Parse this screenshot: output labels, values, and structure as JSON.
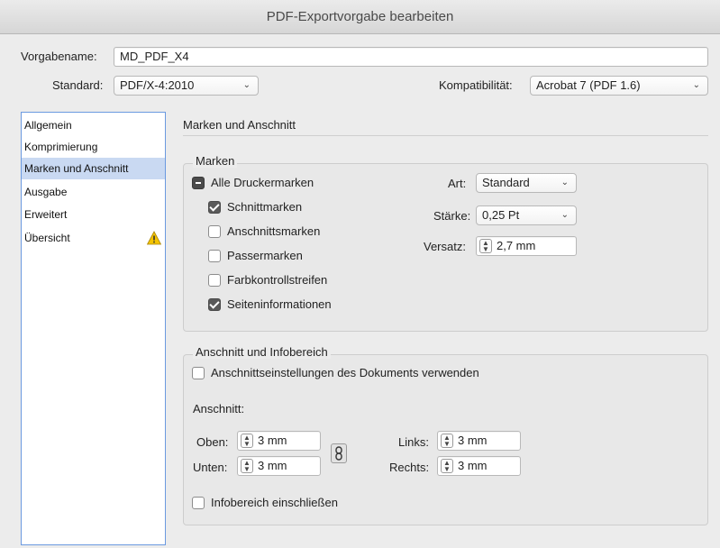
{
  "window": {
    "title": "PDF-Exportvorgabe bearbeiten"
  },
  "preset": {
    "name_label": "Vorgabename:",
    "name_value": "MD_PDF_X4",
    "standard_label": "Standard:",
    "standard_value": "PDF/X-4:2010",
    "compat_label": "Kompatibilität:",
    "compat_value": "Acrobat 7 (PDF 1.6)"
  },
  "sidebar": {
    "items": [
      {
        "label": "Allgemein"
      },
      {
        "label": "Komprimierung"
      },
      {
        "label": "Marken und Anschnitt",
        "selected": true
      },
      {
        "label": "Ausgabe"
      },
      {
        "label": "Erweitert"
      },
      {
        "label": "Übersicht",
        "icon": "warning-icon"
      }
    ]
  },
  "main": {
    "title": "Marken und Anschnitt",
    "marks": {
      "legend": "Marken",
      "all_label": "Alle Druckermarken",
      "all_state": "mixed",
      "items": [
        {
          "label": "Schnittmarken",
          "checked": true
        },
        {
          "label": "Anschnittsmarken",
          "checked": false
        },
        {
          "label": "Passermarken",
          "checked": false
        },
        {
          "label": "Farbkontrollstreifen",
          "checked": false
        },
        {
          "label": "Seiteninformationen",
          "checked": true
        }
      ],
      "type_label": "Art:",
      "type_value": "Standard",
      "weight_label": "Stärke:",
      "weight_value": "0,25 Pt",
      "offset_label": "Versatz:",
      "offset_value": "2,7 mm"
    },
    "bleed": {
      "legend": "Anschnitt und Infobereich",
      "use_doc_label": "Anschnittseinstellungen des Dokuments verwenden",
      "use_doc_checked": false,
      "bleed_label": "Anschnitt:",
      "top_label": "Oben:",
      "top_value": "3 mm",
      "bottom_label": "Unten:",
      "bottom_value": "3 mm",
      "left_label": "Links:",
      "left_value": "3 mm",
      "right_label": "Rechts:",
      "right_value": "3 mm",
      "slug_label": "Infobereich einschließen",
      "slug_checked": false
    }
  },
  "colors": {
    "selection": "#c9d9f2",
    "sidebar_border": "#6b9ae0",
    "warning": "#f5c400"
  }
}
